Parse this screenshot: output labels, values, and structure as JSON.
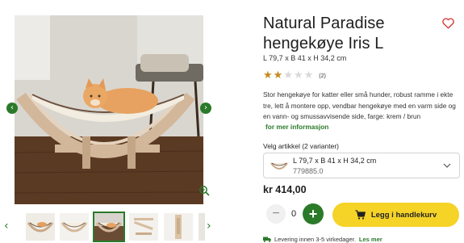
{
  "gallery": {
    "prev_arrow": "‹",
    "next_arrow": "›",
    "thumb_prev": "‹",
    "thumb_next": "›",
    "thumbnail_count": 6,
    "active_thumbnail": 3
  },
  "product": {
    "title": "Natural Paradise hengekøye Iris L",
    "dimensions": "L 79,7 x B 41 x H 34,2 cm",
    "rating": {
      "stars_filled": 2,
      "stars_total": 5,
      "count_label": "(2)"
    },
    "description": "Stor hengekøye for katter eller små hunder, robust ramme i ekte tre, lett å montere opp, vendbar hengekøye med en varm side og en vann- og smussavvisende side, farge: krem / brun",
    "more_info_link": "for mer informasjon",
    "variant_label": "Velg artikkel (2 varianter)",
    "selected_variant": {
      "name": "L 79,7 x B 41 x H 34,2 cm",
      "sku": "779885.0"
    },
    "price": "kr 414,00",
    "quantity": "0",
    "quantity_minus": "−",
    "quantity_plus": "+",
    "add_to_cart_label": "Legg i handlekurv",
    "delivery_text": "Levering innen 3-5 virkedager.",
    "delivery_link": "Les mer"
  },
  "colors": {
    "accent_green": "#2a7a2a",
    "cart_yellow": "#f5d327",
    "star_gold": "#c78a1c",
    "wishlist_red": "#d0312d"
  },
  "icons": {
    "wishlist": "heart-icon",
    "zoom": "zoom-icon",
    "cart": "cart-icon",
    "delivery": "truck-icon",
    "select": "chevron-down-icon"
  }
}
